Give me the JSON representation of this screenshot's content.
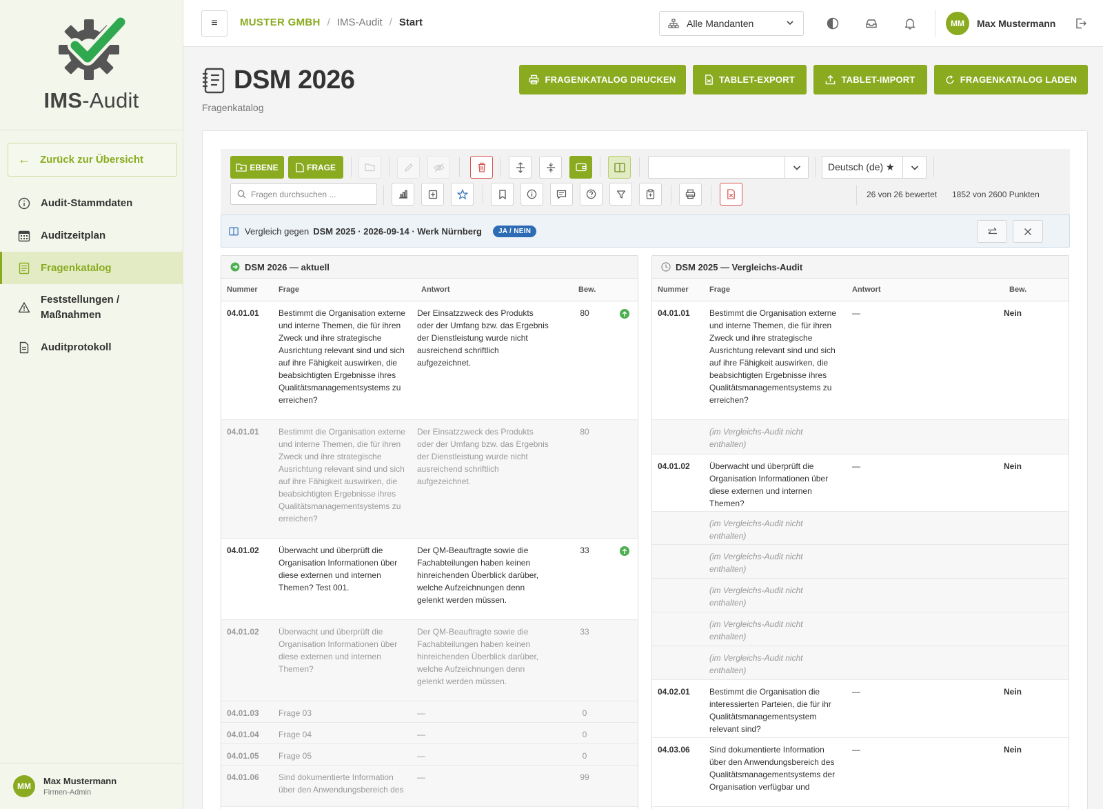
{
  "brand": {
    "logo_bold": "IMS",
    "logo_light": "-Audit"
  },
  "sidebar": {
    "back_label": "Zurück zur Übersicht",
    "items": [
      {
        "label": "Audit-Stammdaten",
        "icon": "info-icon"
      },
      {
        "label": "Auditzeitplan",
        "icon": "calendar-icon"
      },
      {
        "label": "Fragenkatalog",
        "icon": "catalog-icon",
        "active": true
      },
      {
        "label": "Feststellungen /",
        "label2": "Maßnahmen",
        "icon": "warning-icon"
      },
      {
        "label": "Auditprotokoll",
        "icon": "document-icon"
      }
    ],
    "user": {
      "initials": "MM",
      "name": "Max Mustermann",
      "role": "Firmen-Admin"
    }
  },
  "header": {
    "breadcrumb": {
      "company": "MUSTER GMBH",
      "mid": "IMS-Audit",
      "current": "Start"
    },
    "tenant": "Alle Mandanten",
    "user": {
      "initials": "MM",
      "name": "Max Mustermann"
    }
  },
  "page": {
    "title": "DSM 2026",
    "subtitle": "Fragenkatalog",
    "actions": [
      "FRAGENKATALOG DRUCKEN",
      "TABLET-EXPORT",
      "TABLET-IMPORT",
      "FRAGENKATALOG LADEN"
    ]
  },
  "toolbar": {
    "ebene_label": "EBENE",
    "frage_label": "FRAGE",
    "language": "Deutsch (de) ★",
    "level_select": "",
    "search_placeholder": "Fragen durchsuchen ...",
    "rated": "26 von 26 bewertet",
    "points": "1852 von 2600 Punkten"
  },
  "compare": {
    "label": "Vergleich gegen",
    "reference": "DSM 2025 · 2026-09-14 · Werk Nürnberg",
    "badge": "JA / NEIN"
  },
  "left_pane": {
    "title": "DSM 2026 — aktuell",
    "columns": [
      "Nummer",
      "Frage",
      "Antwort",
      "Bew."
    ],
    "rows": [
      {
        "num": "04.01.01",
        "frage": "Bestimmt die Organisation externe und interne Themen, die für ihren Zweck und ihre strategische Ausrichtung relevant sind und sich auf ihre Fähigkeit auswirken, die beabsichtigten Ergebnisse ihres Qualitätsmanagementsystems zu erreichen?",
        "antwort": "Der Einsatzzweck des Produkts oder der Umfang bzw. das Ergebnis der Dienstleistung wurde nicht ausreichend schriftlich aufgezeichnet.",
        "bew": "80",
        "up": true,
        "muted": false
      },
      {
        "num": "04.01.01",
        "frage": "Bestimmt die Organisation externe und interne Themen, die für ihren Zweck und ihre strategische Ausrichtung relevant sind und sich auf ihre Fähigkeit auswirken, die beabsichtigten Ergebnisse ihres Qualitätsmanagementsystems zu erreichen?",
        "antwort": "Der Einsatzzweck des Produkts oder der Umfang bzw. das Ergebnis der Dienstleistung wurde nicht ausreichend schriftlich aufgezeichnet.",
        "bew": "80",
        "up": false,
        "muted": true
      },
      {
        "num": "04.01.02",
        "frage": "Überwacht und überprüft die Organisation Informationen über diese externen und internen Themen? Test 001.",
        "antwort": "Der QM-Beauftragte sowie die Fachabteilungen haben keinen hinreichenden Überblick darüber, welche Aufzeichnungen denn gelenkt werden müssen.",
        "bew": "33",
        "up": true,
        "muted": false
      },
      {
        "num": "04.01.02",
        "frage": "Überwacht und überprüft die Organisation Informationen über diese externen und internen Themen?",
        "antwort": "Der QM-Beauftragte sowie die Fachabteilungen haben keinen hinreichenden Überblick darüber, welche Aufzeichnungen denn gelenkt werden müssen.",
        "bew": "33",
        "up": false,
        "muted": true
      },
      {
        "num": "04.01.03",
        "frage": "Frage 03",
        "antwort": "—",
        "bew": "0",
        "up": false,
        "muted": true
      },
      {
        "num": "04.01.04",
        "frage": "Frage 04",
        "antwort": "—",
        "bew": "0",
        "up": false,
        "muted": true
      },
      {
        "num": "04.01.05",
        "frage": "Frage 05",
        "antwort": "—",
        "bew": "0",
        "up": false,
        "muted": true
      },
      {
        "num": "04.01.06",
        "frage": "Sind dokumentierte Information über den Anwendungsbereich des",
        "antwort": "—",
        "bew": "99",
        "up": false,
        "muted": true
      }
    ]
  },
  "right_pane": {
    "title": "DSM 2025 — Vergleichs-Audit",
    "columns": [
      "Nummer",
      "Frage",
      "Antwort",
      "Bew."
    ],
    "missing_text": "(im Vergleichs-Audit nicht enthalten)",
    "rows": [
      {
        "num": "04.01.01",
        "frage": "Bestimmt die Organisation externe und interne Themen, die für ihren Zweck und ihre strategische Ausrichtung relevant sind und sich auf ihre Fähigkeit auswirken, die beabsichtigten Ergebnisse ihres Qualitätsmanagementsystems zu erreichen?",
        "antwort": "—",
        "bew": "Nein",
        "missing": false
      },
      {
        "missing": true
      },
      {
        "num": "04.01.02",
        "frage": "Überwacht und überprüft die Organisation Informationen über diese externen und internen Themen?",
        "antwort": "—",
        "bew": "Nein",
        "missing": false
      },
      {
        "missing": true
      },
      {
        "missing": true
      },
      {
        "missing": true
      },
      {
        "missing": true
      },
      {
        "missing": true
      },
      {
        "num": "04.02.01",
        "frage": "Bestimmt die Organisation die interessierten Parteien, die für ihr Qualitätsmanagementsystem relevant sind?",
        "antwort": "—",
        "bew": "Nein",
        "missing": false
      },
      {
        "num": "04.03.06",
        "frage": "Sind dokumentierte Information über den Anwendungsbereich des Qualitätsmanagementsystems der Organisation verfügbar und",
        "antwort": "—",
        "bew": "Nein",
        "missing": false
      }
    ]
  },
  "colors": {
    "accent": "#8aab1f",
    "badge": "#2d6cb5",
    "up": "#4caf50",
    "danger": "#d9534f"
  }
}
